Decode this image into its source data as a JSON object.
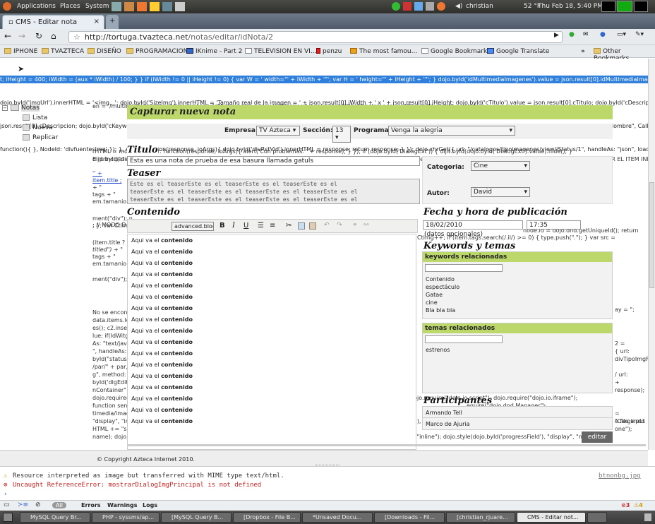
{
  "panel": {
    "applications": "Applications",
    "places": "Places",
    "system": "System",
    "user": "christian",
    "temp": "52 °F",
    "clock": "Thu Feb 18, 5:40 PM"
  },
  "browser": {
    "tab_title": "CMS - Editar nota",
    "url_host": "http://tortuga.tvazteca.net",
    "url_path": "/notas/editar/idNota/2"
  },
  "bookmarks": [
    "IPHONE",
    "TVAZTECA",
    "DISEÑO",
    "PROGRAMACION",
    "IKnime - Part 2",
    "TELEVISION EN VI...",
    "penzu",
    "The most famou...",
    "Google Bookmark",
    "Google Translate",
    "Other Bookmarks"
  ],
  "code_lines": [
    "t; iHeight = 400; iWidth = (aux * iWidth) / 100; } } if (iWidth != 0 || iHeight != 0) { var W = ' width=\"' + iWidth + '\"'; var H = ' height=\"' + iHeight + '\"'; } dojo.byId('idMultimediaImagenes').value = json.result[0].idMultimediaImagenes;",
    "dojo.byId('imgUrl').innerHTML = '<img...'; dojo.byId('SizeImg').innerHTML = 'Tamaño real de la imagen = ' + json.result[0].iWidth + ' x ' + json.result[0].iHeight; dojo.byId('cTitulo').value = json.result[0].cTitulo; dojo.byId('cDescripcion').value =",
    "json.result[0].cDescripcion; dojo.byId('cKeyword').value = json.result[0].cKeyWords; dojo.byId('cPath').value = json.result[0].cPath; combo({ Url: \"/catalogos/fuenteimagenes/view/iStatus/1\", Key: \"idFuente\", Value: \"cNombre\", Callback:",
    "function(){ }, NodeId: 'divfuenteslmg' }); }, error: function(response, ioArgs){ dojo.byId('divRstVid').innerHTML = response; return response; } }); dojo.xhrGet({ url: \"/catalogos/tipoimagenes/view/iStatus/1\", handleAs: \"json\", load:"
  ],
  "tree": {
    "root": "Notas",
    "items": [
      "Lista",
      "Nueva",
      "Replicar"
    ]
  },
  "form": {
    "header": "Capturar nueva nota",
    "empresa_label": "Empresa:",
    "empresa": "TV Azteca",
    "seccion_label": "Sección:",
    "seccion": "13",
    "programa_label": "Programa:",
    "programa": "Venga la alegria",
    "titulo_label": "Titulo",
    "titulo": "Esta es una nota de prueba de esa basura llamada gatuls",
    "teaser_label": "Teaser",
    "teaser_lines": [
      "Este es el teaserEste es el teaserEste es el teaserEste es el",
      "teaserEste es el teaserEste es el teaserEste es el teaserEste es el",
      "teaserEste es el teaserEste es el teaserEste es el teaserEste es el"
    ],
    "contenido_label": "Contenido",
    "editor_select": "advanced.block",
    "editor_lines_prefix": "Aqui va el ",
    "editor_lines_bold": "contenido",
    "categoria_label": "Categoria:",
    "categoria": "Cine",
    "autor_label": "Autor:",
    "autor": "David",
    "fecha_label": "Fecha y hora de publicación",
    "fecha": "18/02/2010",
    "hora": "17:35",
    "opcionales": "(datos opcionales)",
    "keywords_label": "Keywords y temas",
    "kw_header": "keywords relacionadas",
    "keywords": [
      "Contenido",
      "espectáculo",
      "Gatae",
      "cine",
      "Bla bla bla"
    ],
    "temas_header": "temas relacionados",
    "temas": [
      "estrenos"
    ],
    "participantes_label": "Participantes",
    "participantes": [
      "Armando Tell",
      "Marco de Ajuria"
    ],
    "editar": "editar"
  },
  "footer": "© Copyright Azteca Internet 2010.",
  "console": {
    "warn": "Resource interpreted as image but transferred with MIME type text/html.",
    "error": "Uncaught ReferenceError: mostrarDialogImgPrincipal is not defined",
    "file": "btnonbg.jpg",
    "filter_all": "All",
    "errors": "Errors",
    "warnings": "Warnings",
    "logs": "Logs",
    "err_count": "3",
    "warn_count": "4"
  },
  "tasks": [
    "MySQL Query Br...",
    "PHP - syssms/ap...",
    "[MySQL Query B...",
    "[Dropbox - File B...",
    "*Unsaved Docu...",
    "[Downloads - Fil...",
    "[christian_rjuare...",
    "CMS - Editar not..."
  ],
  "colors": {
    "green": "#bcd86b",
    "selection": "#2f7fdc"
  }
}
